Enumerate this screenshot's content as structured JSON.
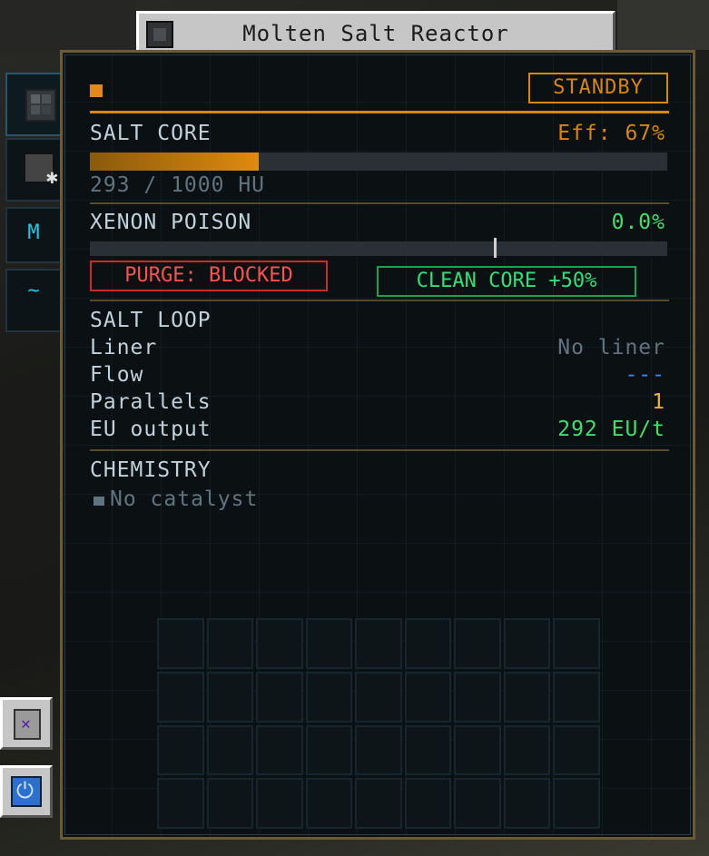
{
  "window": {
    "title": "Molten Salt Reactor",
    "title_icon": "reactor-block-icon"
  },
  "side_tabs": [
    {
      "icon": "reactor-cube-icon"
    },
    {
      "icon": "settings-gear-icon"
    },
    {
      "glyph": "M"
    },
    {
      "glyph": "~"
    }
  ],
  "side_buttons": [
    {
      "icon": "trash-icon"
    },
    {
      "icon": "power-icon"
    }
  ],
  "header": {
    "status": "STANDBY"
  },
  "salt_core": {
    "title": "SALT CORE",
    "efficiency": "Eff: 67%",
    "heat_text": "293 / 1000 HU",
    "heat_fraction": 0.293
  },
  "xenon": {
    "title": "XENON POISON",
    "value": "0.0%",
    "marker_fraction": 0.7,
    "purge_label": "PURGE: BLOCKED",
    "clean_label": "CLEAN CORE +50%"
  },
  "salt_loop": {
    "title": "SALT LOOP",
    "rows": [
      {
        "label": "Liner",
        "value": "No liner",
        "color": "#5f7480"
      },
      {
        "label": "Flow",
        "value": "---",
        "color": "#2f8aff"
      },
      {
        "label": "Parallels",
        "value": "1",
        "color": "#f0b040"
      },
      {
        "label": "EU output",
        "value": "292 EU/t",
        "color": "#3ee06a"
      }
    ]
  },
  "chemistry": {
    "title": "CHEMISTRY",
    "catalyst": "No catalyst"
  },
  "colors": {
    "accent": "#d8860e",
    "frame": "#6b5a33",
    "ok": "#2ee07a",
    "bad": "#ff5050"
  }
}
